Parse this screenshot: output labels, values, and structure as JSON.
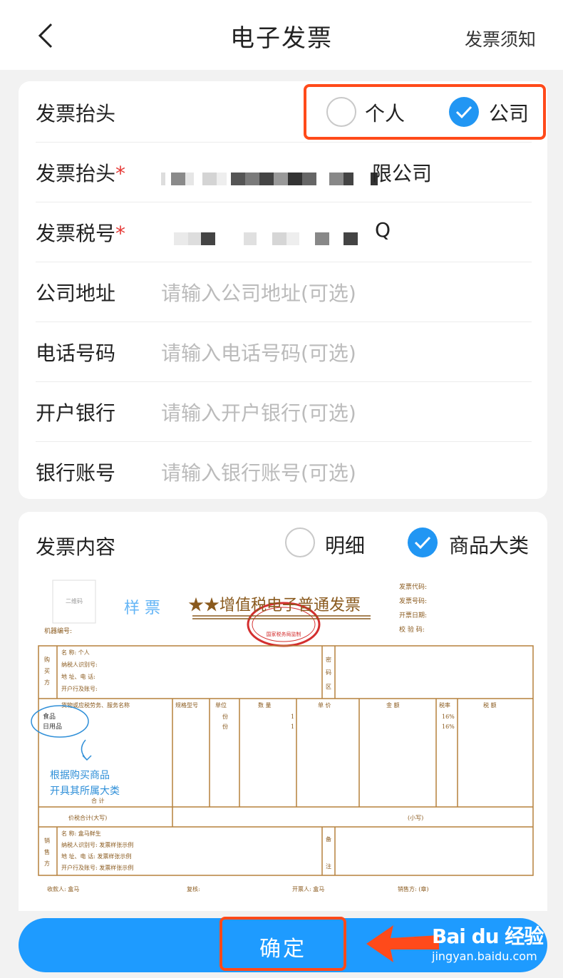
{
  "header": {
    "title": "电子发票",
    "notice_link": "发票须知"
  },
  "invoice_title_type": {
    "label": "发票抬头",
    "options": [
      {
        "label": "个人",
        "selected": false
      },
      {
        "label": "公司",
        "selected": true
      }
    ]
  },
  "form": {
    "company_name": {
      "label": "发票抬头",
      "required_mark": "*",
      "visible_suffix": "限公司"
    },
    "tax_number": {
      "label": "发票税号",
      "required_mark": "*",
      "visible_suffix": "Q"
    },
    "address": {
      "label": "公司地址",
      "placeholder": "请输入公司地址(可选)"
    },
    "phone": {
      "label": "电话号码",
      "placeholder": "请输入电话号码(可选)"
    },
    "bank": {
      "label": "开户银行",
      "placeholder": "请输入开户银行(可选)"
    },
    "account": {
      "label": "银行账号",
      "placeholder": "请输入银行账号(可选)"
    }
  },
  "invoice_content": {
    "label": "发票内容",
    "options": [
      {
        "label": "明细",
        "selected": false
      },
      {
        "label": "商品大类",
        "selected": true
      }
    ]
  },
  "sample_invoice": {
    "qr_label": "二维码",
    "sample_stamp": "样 票",
    "title": "★★增值税电子普通发票",
    "seal_text": "国家税务局监制",
    "meta": [
      "发票代码:",
      "发票号码:",
      "开票日期:",
      "校 验 码:"
    ],
    "machine_no": "机器编号:",
    "buyer_side": "购买方",
    "buyer_fields": [
      "名      称: 个人",
      "纳税人识别号:",
      "地 址、电 话:",
      "开户行及账号:"
    ],
    "password_area": "密码区",
    "columns": [
      "货物或应税劳务、服务名称",
      "规格型号",
      "单位",
      "数 量",
      "单 价",
      "金 额",
      "税率",
      "税 额"
    ],
    "items": [
      {
        "name": "食品",
        "unit": "份",
        "qty": "1",
        "rate": "16%"
      },
      {
        "name": "日用品",
        "unit": "份",
        "qty": "1",
        "rate": "16%"
      }
    ],
    "annotation": [
      "根据购买商品",
      "开具其所属大类"
    ],
    "total_label": "合      计",
    "tax_total_label": "价税合计(大写)",
    "small_label": "(小写)",
    "seller_side": "销售方",
    "seller_fields": [
      "名      称: 盒马鲜生",
      "纳税人识别号: 发票样张示例",
      "地 址、电 话: 发票样张示例",
      "开户行及账号: 发票样张示例"
    ],
    "remark_area": "备注",
    "footer": [
      "收款人: 盒马",
      "复核:",
      "开票人: 盒马",
      "销售方: (章)"
    ]
  },
  "confirm_button": "确定",
  "watermark": {
    "main": "Bai du 经验",
    "sub": "jingyan.baidu.com"
  },
  "colors": {
    "accent": "#2196f3",
    "highlight": "#ff4a1a",
    "invoice_line": "#b5803c"
  }
}
